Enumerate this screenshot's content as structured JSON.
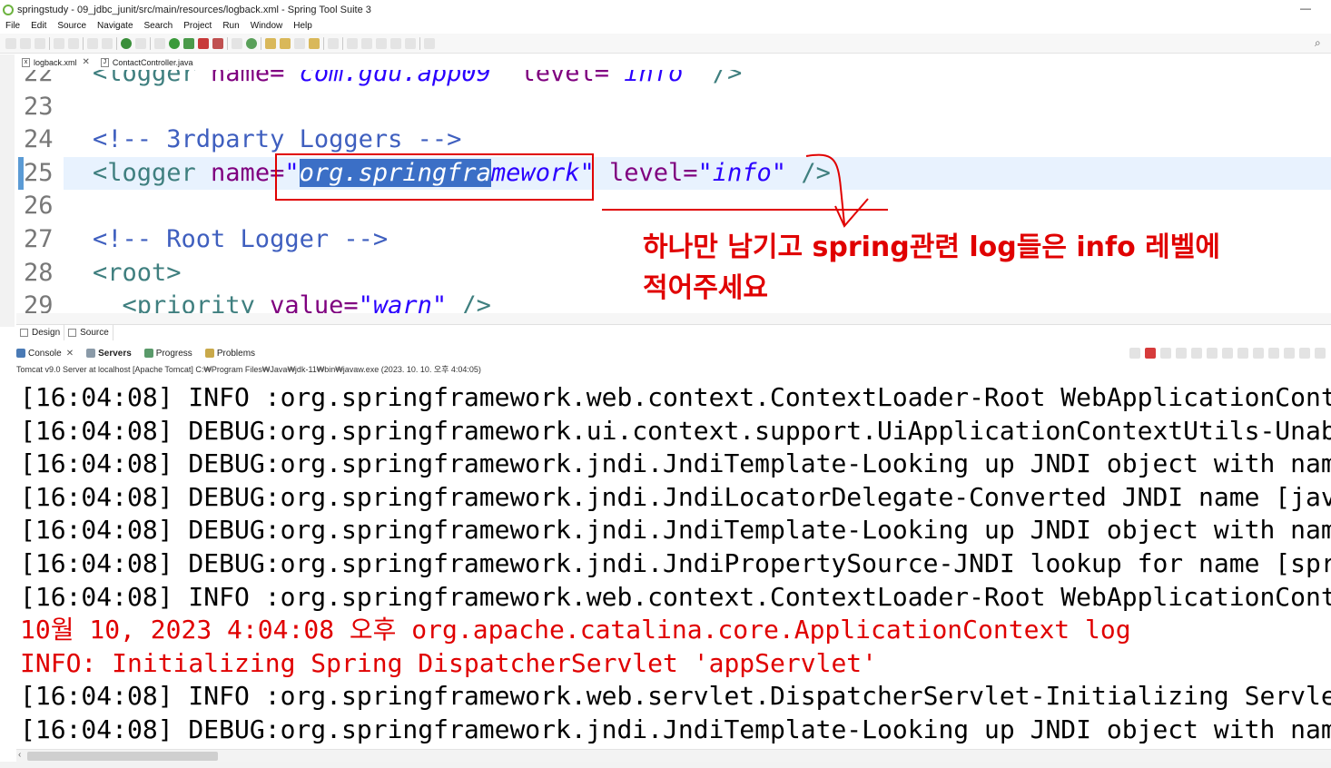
{
  "window": {
    "title": "springstudy - 09_jdbc_junit/src/main/resources/logback.xml - Spring Tool Suite 3",
    "minimize": "—"
  },
  "menu": [
    "File",
    "Edit",
    "Source",
    "Navigate",
    "Search",
    "Project",
    "Run",
    "Window",
    "Help"
  ],
  "editor_tabs": [
    {
      "label": "logback.xml",
      "close": "✕",
      "icon": "xml-file-icon"
    },
    {
      "label": "ContactController.java",
      "icon": "java-file-icon"
    }
  ],
  "editor": {
    "lines": [
      {
        "num": "22",
        "parts": [
          [
            "tag",
            "<logger "
          ],
          [
            "attr",
            "name="
          ],
          [
            "str",
            "\"com.gdu.app09\""
          ],
          [
            "plain",
            " "
          ],
          [
            "attr",
            "level="
          ],
          [
            "str",
            "\"info\""
          ],
          [
            "tag",
            " />"
          ]
        ]
      },
      {
        "num": "23",
        "parts": []
      },
      {
        "num": "24",
        "parts": [
          [
            "cmt",
            "<!-- 3rdparty Loggers -->"
          ]
        ]
      },
      {
        "num": "25",
        "parts": [
          [
            "tag",
            "<logger "
          ],
          [
            "attr",
            "name="
          ],
          [
            "str",
            "\""
          ],
          [
            "sel",
            "org.springfra"
          ],
          [
            "str",
            "mework\""
          ],
          [
            "plain",
            " "
          ],
          [
            "attr",
            "level="
          ],
          [
            "str",
            "\"info\""
          ],
          [
            "tag",
            " />"
          ]
        ]
      },
      {
        "num": "26",
        "parts": []
      },
      {
        "num": "27",
        "parts": [
          [
            "cmt",
            "<!-- Root Logger -->"
          ]
        ]
      },
      {
        "num": "28",
        "parts": [
          [
            "tag",
            "<root>"
          ]
        ]
      },
      {
        "num": "29",
        "parts": [
          [
            "tag",
            "  <priority "
          ],
          [
            "attr",
            "value="
          ],
          [
            "str",
            "\"warn\""
          ],
          [
            "tag",
            " />"
          ]
        ]
      }
    ],
    "annotation": {
      "line1": "하나만 남기고 spring관련 log들은 info 레벨에",
      "line2": "적어주세요"
    }
  },
  "editor_bottom_tabs": [
    "Design",
    "Source"
  ],
  "console_tabs": [
    {
      "label": "Console",
      "close": "✕",
      "icon": "console-icon"
    },
    {
      "label": "Servers",
      "icon": "servers-icon"
    },
    {
      "label": "Progress",
      "icon": "progress-icon"
    },
    {
      "label": "Problems",
      "icon": "problems-icon"
    }
  ],
  "console_status": "Tomcat v9.0 Server at localhost [Apache Tomcat] C:₩Program Files₩Java₩jdk-11₩bin₩javaw.exe  (2023. 10. 10. 오후 4:04:05)",
  "console_lines": [
    {
      "type": "out",
      "text": "[16:04:08] INFO :org.springframework.web.context.ContextLoader-Root WebApplicationContext: "
    },
    {
      "type": "out",
      "text": "[16:04:08] DEBUG:org.springframework.ui.context.support.UiApplicationContextUtils-Unable to"
    },
    {
      "type": "out",
      "text": "[16:04:08] DEBUG:org.springframework.jndi.JndiTemplate-Looking up JNDI object with name [ja"
    },
    {
      "type": "out",
      "text": "[16:04:08] DEBUG:org.springframework.jndi.JndiLocatorDelegate-Converted JNDI name [java:com"
    },
    {
      "type": "out",
      "text": "[16:04:08] DEBUG:org.springframework.jndi.JndiTemplate-Looking up JNDI object with name [sp"
    },
    {
      "type": "out",
      "text": "[16:04:08] DEBUG:org.springframework.jndi.JndiPropertySource-JNDI lookup for name [spring.l"
    },
    {
      "type": "out",
      "text": "[16:04:08] INFO :org.springframework.web.context.ContextLoader-Root WebApplicationContext i"
    },
    {
      "type": "err",
      "text": "10월 10, 2023 4:04:08 오후 org.apache.catalina.core.ApplicationContext log"
    },
    {
      "type": "err",
      "text": "INFO: Initializing Spring DispatcherServlet 'appServlet'"
    },
    {
      "type": "out",
      "text": "[16:04:08] INFO :org.springframework.web.servlet.DispatcherServlet-Initializing Servlet 'ap"
    },
    {
      "type": "out",
      "text": "[16:04:08] DEBUG:org.springframework.jndi.JndiTemplate-Looking up JNDI object with name [ja"
    }
  ],
  "colors": {
    "annotation": "#e00000",
    "selection": "#3b6fc6",
    "current_line": "#e8f2fe"
  }
}
